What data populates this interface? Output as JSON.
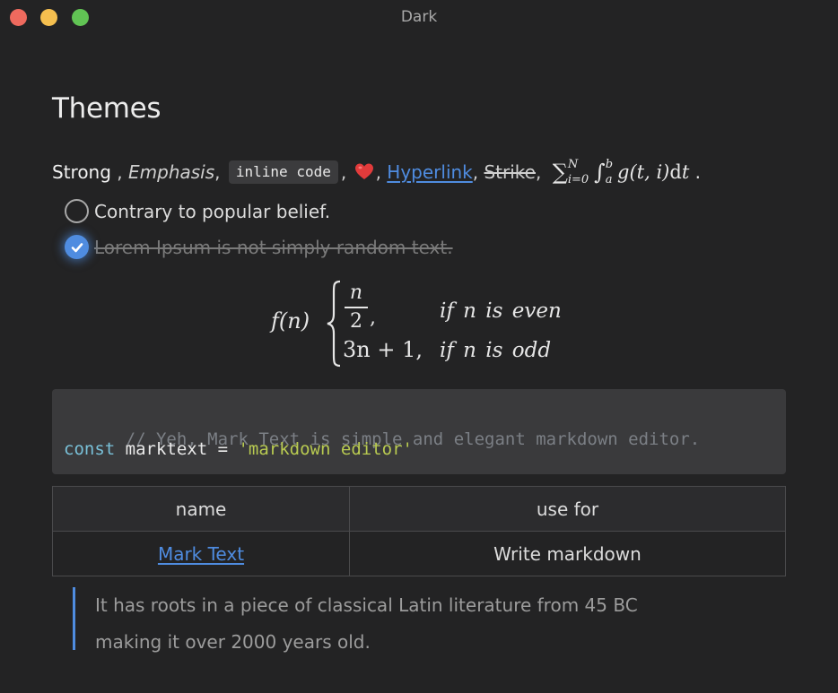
{
  "window": {
    "title": "Dark"
  },
  "document": {
    "heading": "Themes",
    "inline": {
      "strong": "Strong",
      "sep1": " , ",
      "emphasis": "Emphasis",
      "sep2": ", ",
      "inline_code": "inline code",
      "sep3": ", ",
      "emoji": "heart-emoji",
      "sep4": ", ",
      "hyperlink": "Hyperlink",
      "sep5": ", ",
      "strike": "Strike",
      "sep6": ", ",
      "math_sigma": "∑",
      "math_sigma_sup": "N",
      "math_sigma_sub": "i=0",
      "math_integral": "∫",
      "math_int_sup": "b",
      "math_int_sub": "a",
      "math_body": "g(t, i)",
      "math_d": "d",
      "math_t": "t",
      "math_end": " ."
    },
    "tasks": [
      {
        "text": "Contrary to popular belief.",
        "checked": false
      },
      {
        "text": "Lorem Ipsum is not simply random text.",
        "checked": true
      }
    ],
    "block_math": {
      "fn": "f(n)",
      "frac_num": "n",
      "frac_den": "2",
      "comma": ",",
      "row2": "3n + 1,",
      "cond1": "if n is even",
      "cond2": "if n is odd"
    },
    "code_block": {
      "comment": "// Yeh, Mark Text is simple and elegant markdown editor.",
      "keyword": "const",
      "identifier": " marktext = ",
      "string": "'markdown editor'"
    },
    "table": {
      "headers": [
        "name",
        "use for"
      ],
      "rows": [
        [
          "Mark Text",
          "Write markdown"
        ]
      ]
    },
    "blockquote": {
      "line1": "It has roots in a piece of classical Latin literature from 45 BC",
      "line2": "making it over 2000 years old."
    }
  },
  "colors": {
    "background": "#232324",
    "accent": "#4f8ce0",
    "code_background": "#3a3a3c",
    "string": "#b9cb51",
    "keyword": "#79c0d8"
  }
}
